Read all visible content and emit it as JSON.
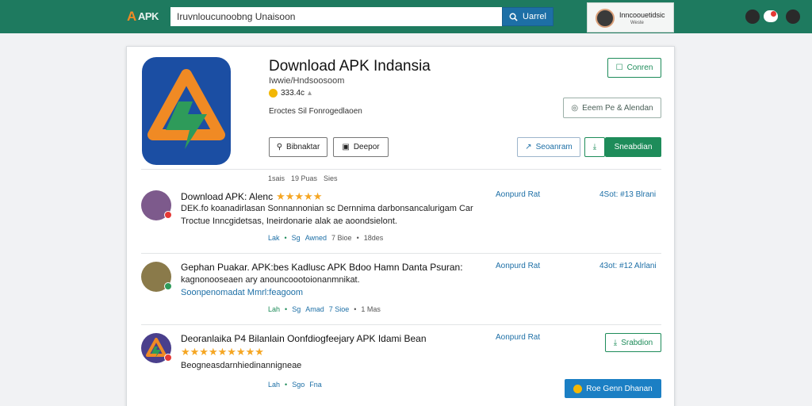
{
  "header": {
    "logo_mark": "A",
    "logo_text": "APK",
    "search_value": "Iruvnloucunoobng Unaisoon",
    "search_button_label": "Uarrel",
    "account_name": "Inncoouetidsic",
    "account_sub": "Weste"
  },
  "app": {
    "title": "Download APK Indansia",
    "developer": "Iwwie/Hndsoosoom",
    "rating": "333.4c",
    "description": "Eroctes Sil Fonrogedlaoen",
    "buttons": {
      "contact": "Conren",
      "install_link": "Eeem Pe & Alendan",
      "primary_left": "Bibnaktar",
      "secondary_left": "Deepor",
      "share": "Seoanram",
      "install": "Sneabdian"
    },
    "meta": [
      "1sais",
      "19 Puas",
      "Sies"
    ]
  },
  "reviews": [
    {
      "title": "Download APK: Alenc",
      "stars": "★★★★★",
      "line1": "DEK.fo koanadirlasan Sonnannonian sc Dernnima darbonsancalurigam Car",
      "line2": "Troctue Inncgidetsas, Ineirdonarie alak ae aoondsielont.",
      "status": "Aonpurd Rat",
      "date": "4Sot: #13 Blrani",
      "meta": [
        "Lak",
        "•",
        "Sg",
        "Awned",
        "7 Bioe",
        "•",
        "18des"
      ]
    },
    {
      "title": "Gephan Puakar. APK:bes Kadlusc APK Bdoo Hamn Danta Psuran:",
      "line1": "kagnonooseaen ary anouncoootoionanmnikat.",
      "line2": "Soonpenomadat Mmrl:feagoom",
      "status": "Aonpurd Rat",
      "date": "43ot: #12 Alrlani",
      "meta": [
        "Lah",
        "•",
        "Sg",
        "Amad",
        "7 Sioe",
        "•",
        "1 Mas"
      ]
    },
    {
      "title": "Deoranlaika P4 Bilanlain Oonfdiogfeejary APK Idami Bean",
      "stars": "★★★★★★★★★",
      "line1": "Beogneasdarnhiedinannigneae",
      "status": "Aonpurd Rat",
      "meta": [
        "Lah",
        "•",
        "Sgo",
        "Fna"
      ],
      "button_outline": "Srabdion",
      "button_filled": "Roe Genn Dhanan"
    }
  ],
  "colors": {
    "topbar": "#1e7a5f",
    "accent_blue": "#1d6fa6",
    "accent_green": "#1e8c5a",
    "star": "#f5a623",
    "icon_bg": "#1b4ea3",
    "icon_orange": "#f08a24",
    "icon_green": "#2e9b5a"
  }
}
